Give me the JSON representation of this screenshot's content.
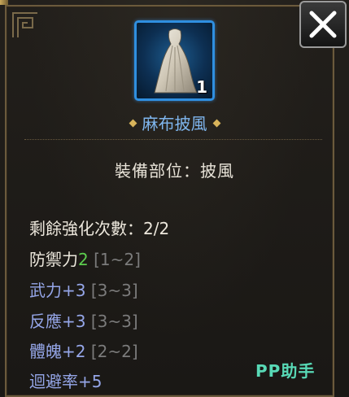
{
  "item": {
    "name": "麻布披風",
    "count": "1",
    "slot_line": "裝備部位：披風",
    "rarity_color": "#2f8fe0"
  },
  "stats": {
    "enhance": "剩餘強化次數：2/2",
    "defense_label": "防禦力",
    "defense_value": "2",
    "defense_range": "[1~2]",
    "lines": [
      {
        "label": "武力+3",
        "range": "[3~3]"
      },
      {
        "label": "反應+3",
        "range": "[3~3]"
      },
      {
        "label": "體魄+2",
        "range": "[2~2]"
      },
      {
        "label": "迴避率+5",
        "range": ""
      }
    ]
  },
  "watermark": "PP助手",
  "icons": {
    "close": "close-x-icon",
    "item": "cloak-icon",
    "ornament": "corner-ornament-icon",
    "diamond": "diamond-bullet-icon"
  }
}
